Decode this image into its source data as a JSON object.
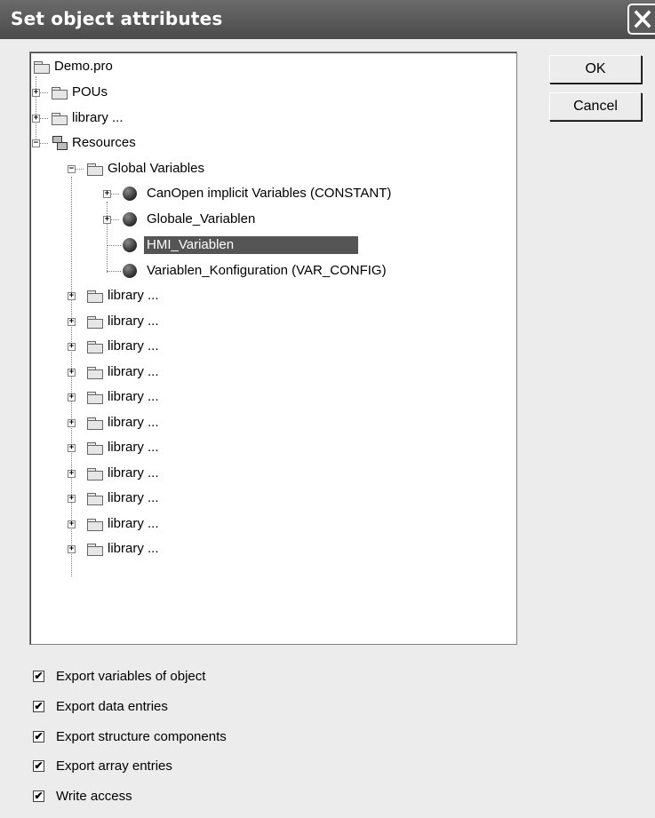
{
  "window": {
    "title": "Set object attributes"
  },
  "buttons": {
    "ok": "OK",
    "cancel": "Cancel"
  },
  "tree": {
    "root": "Demo.pro",
    "pous": "POUs",
    "library": "library ...",
    "resources": "Resources",
    "global_variables": "Global Variables",
    "gv_items": [
      "CanOpen implicit Variables (CONSTANT)",
      "Globale_Variablen",
      "HMI_Variablen",
      "Variablen_Konfiguration (VAR_CONFIG)"
    ],
    "selected": "HMI_Variablen"
  },
  "options": [
    {
      "label": "Export variables of object",
      "checked": true
    },
    {
      "label": "Export data entries",
      "checked": true
    },
    {
      "label": "Export structure components",
      "checked": true
    },
    {
      "label": "Export array entries",
      "checked": true
    },
    {
      "label": "Write access",
      "checked": true
    }
  ],
  "check_glyph": "✔"
}
